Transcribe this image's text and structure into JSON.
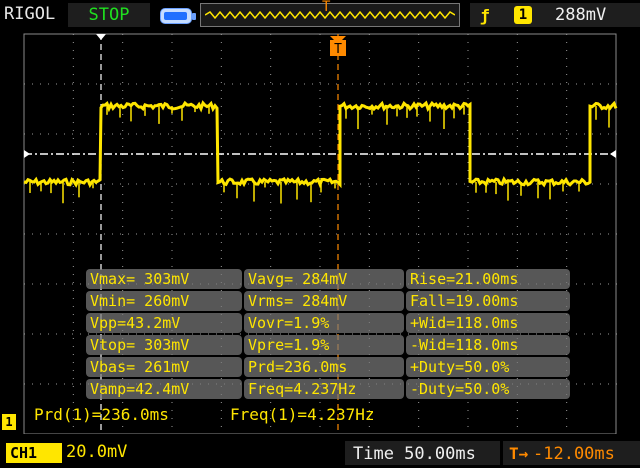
{
  "header": {
    "brand": "RIGOL",
    "run_state": "STOP",
    "trigger_channel": "1",
    "trigger_level": "288mV",
    "trigger_marker": "T"
  },
  "measurements": [
    [
      "Vmax= 303mV",
      "Vavg= 284mV",
      "Rise=21.00ms"
    ],
    [
      "Vmin= 260mV",
      "Vrms= 284mV",
      "Fall=19.00ms"
    ],
    [
      "Vpp=43.2mV",
      "Vovr=1.9%",
      "+Wid=118.0ms"
    ],
    [
      "Vtop= 303mV",
      "Vpre=1.9%",
      "-Wid=118.0ms"
    ],
    [
      "Vbas= 261mV",
      "Prd=236.0ms",
      "+Duty=50.0%"
    ],
    [
      "Vamp=42.4mV",
      "Freq=4.237Hz",
      "-Duty=50.0%"
    ]
  ],
  "cursor_readout": {
    "prd": "Prd(1)=236.0ms",
    "freq": "Freq(1)=4.237Hz"
  },
  "footer": {
    "ch1_label": "CH1",
    "ch1_scale": "20.0mV",
    "timebase": "Time 50.00ms",
    "trigger_offset": "-12.00ms",
    "ground_marker": "1"
  },
  "colors": {
    "trace": "#ffe600",
    "trigger": "#ff8a00",
    "run_state": "#1fe01f",
    "grid": "#9a9a9a"
  },
  "icons": {
    "edge": "rising-edge-icon",
    "battery": "battery-icon",
    "trigger_pos": "trigger-position-icon",
    "offset": "trigger-offset-icon"
  }
}
